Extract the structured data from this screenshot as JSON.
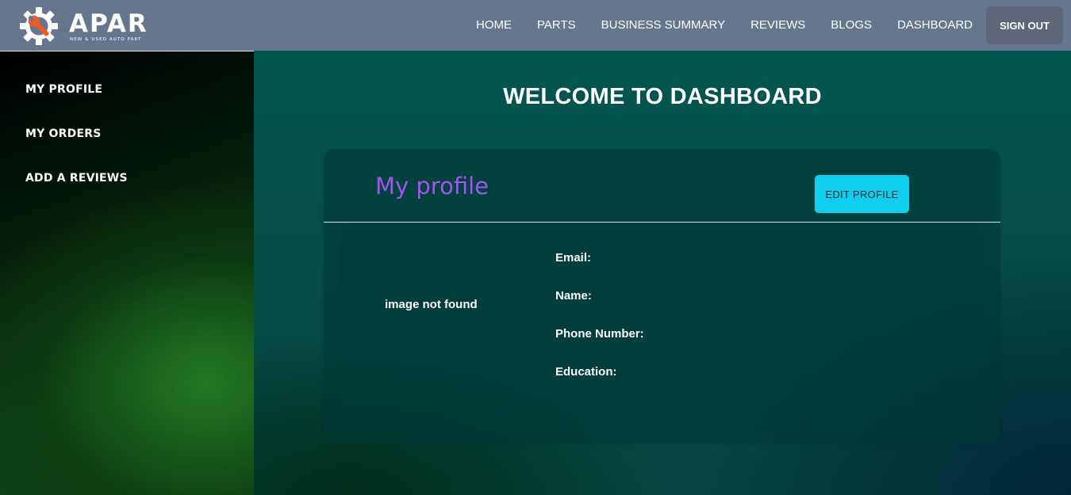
{
  "brand": {
    "name": "APAR",
    "tagline": "NEW & USED AUTO PART",
    "logo_icon": "gear-wrench-icon"
  },
  "nav": {
    "links": [
      "HOME",
      "PARTS",
      "BUSINESS SUMMARY",
      "REVIEWS",
      "BLOGS",
      "DASHBOARD"
    ],
    "signout_label": "SIGN OUT"
  },
  "sidebar": {
    "items": [
      "MY PROFILE",
      "MY ORDERS",
      "ADD A REVIEWS"
    ]
  },
  "main": {
    "title": "WELCOME TO DASHBOARD",
    "profile": {
      "title": "My profile",
      "edit_label": "EDIT PROFILE",
      "image_alt": "image not found",
      "fields": [
        "Email:",
        "Name:",
        "Phone Number:",
        "Education:"
      ]
    }
  },
  "colors": {
    "navbar": "#67768f",
    "accent_cyan": "#10cfee",
    "profile_title": "#a453ee",
    "logo_orange": "#f15a24"
  }
}
